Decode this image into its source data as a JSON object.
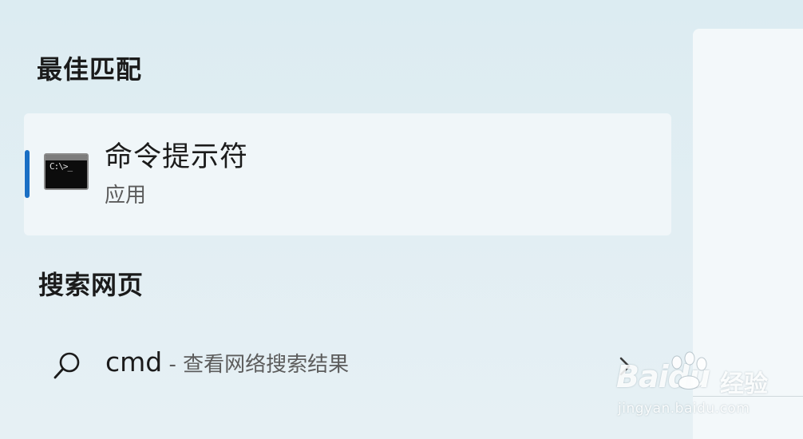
{
  "best_match": {
    "title": "最佳匹配",
    "result": {
      "app_name": "命令提示符",
      "app_type": "应用",
      "icon": "command-prompt-icon",
      "icon_text": "C:\\>_"
    }
  },
  "web_search": {
    "title": "搜索网页",
    "query": "cmd",
    "separator": " - ",
    "description": "查看网络搜索结果",
    "icon": "search-icon",
    "chevron": "chevron-right-icon"
  },
  "watermark": {
    "logo": "Baidu",
    "label": "经验",
    "url": "jingyan.baidu.com"
  },
  "colors": {
    "accent": "#1a6fc4",
    "background": "#dfeef3",
    "card": "#f0f6f9"
  }
}
